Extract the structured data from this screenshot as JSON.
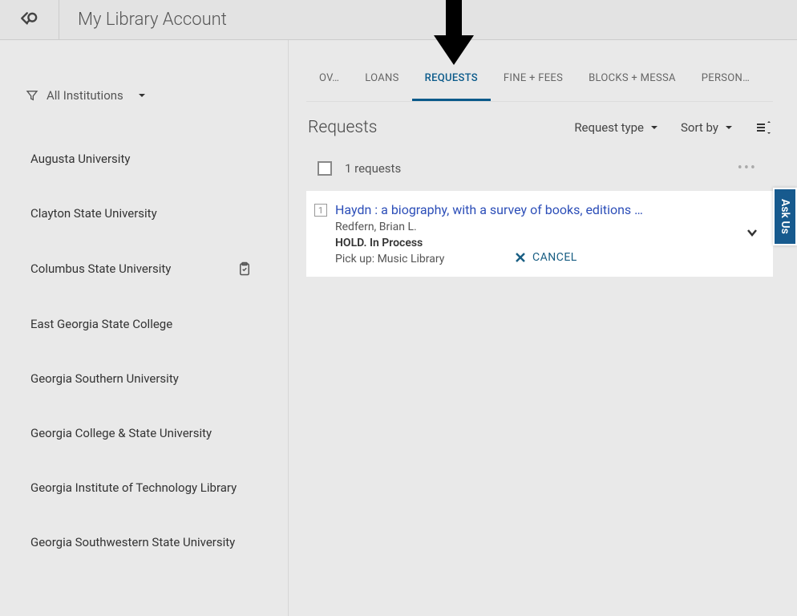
{
  "header": {
    "title": "My Library Account"
  },
  "sidebar": {
    "filter_label": "All Institutions",
    "items": [
      {
        "label": "Augusta University",
        "has_icon": false
      },
      {
        "label": "Clayton State University",
        "has_icon": false
      },
      {
        "label": "Columbus State University",
        "has_icon": true
      },
      {
        "label": "East Georgia State College",
        "has_icon": false
      },
      {
        "label": "Georgia Southern University",
        "has_icon": false
      },
      {
        "label": "Georgia College & State University",
        "has_icon": false
      },
      {
        "label": "Georgia Institute of Technology Library",
        "has_icon": false
      },
      {
        "label": "Georgia Southwestern State University",
        "has_icon": false
      }
    ]
  },
  "tabs": [
    {
      "label": "OV…",
      "active": false
    },
    {
      "label": "LOANS",
      "active": false
    },
    {
      "label": "REQUESTS",
      "active": true
    },
    {
      "label": "FINE + FEES",
      "active": false
    },
    {
      "label": "BLOCKS + MESSA",
      "active": false
    },
    {
      "label": "PERSON…",
      "active": false
    }
  ],
  "section": {
    "title": "Requests",
    "request_type_label": "Request type",
    "sort_by_label": "Sort by"
  },
  "list": {
    "count_label": "1 requests"
  },
  "request": {
    "index": "1",
    "title": "Haydn : a biography, with a survey of books, editions …",
    "author": "Redfern, Brian L.",
    "status": "HOLD. In Process",
    "pickup": "Pick up: Music Library",
    "cancel_label": "CANCEL"
  },
  "ask_us": {
    "label": "Ask Us"
  }
}
